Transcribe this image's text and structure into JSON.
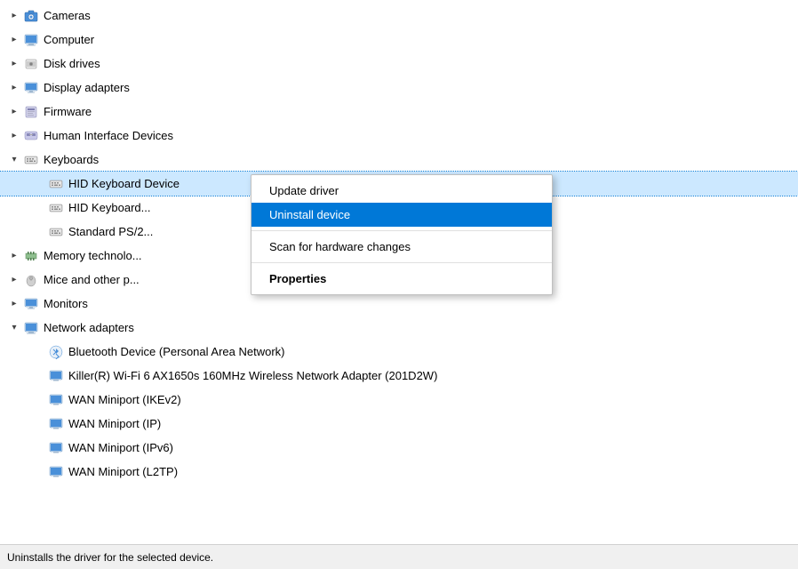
{
  "statusBar": {
    "text": "Uninstalls the driver for the selected device."
  },
  "contextMenu": {
    "items": [
      {
        "id": "update-driver",
        "label": "Update driver",
        "bold": false,
        "active": false
      },
      {
        "id": "uninstall-device",
        "label": "Uninstall device",
        "bold": false,
        "active": true
      },
      {
        "divider": true
      },
      {
        "id": "scan-changes",
        "label": "Scan for hardware changes",
        "bold": false,
        "active": false
      },
      {
        "divider": true
      },
      {
        "id": "properties",
        "label": "Properties",
        "bold": true,
        "active": false
      }
    ]
  },
  "tree": {
    "items": [
      {
        "id": "cameras",
        "label": "Cameras",
        "level": 0,
        "arrow": "collapsed",
        "icon": "camera"
      },
      {
        "id": "computer",
        "label": "Computer",
        "level": 0,
        "arrow": "collapsed",
        "icon": "computer"
      },
      {
        "id": "disk-drives",
        "label": "Disk drives",
        "level": 0,
        "arrow": "collapsed",
        "icon": "disk"
      },
      {
        "id": "display-adapters",
        "label": "Display adapters",
        "level": 0,
        "arrow": "collapsed",
        "icon": "display"
      },
      {
        "id": "firmware",
        "label": "Firmware",
        "level": 0,
        "arrow": "collapsed",
        "icon": "firmware"
      },
      {
        "id": "human-interface",
        "label": "Human Interface Devices",
        "level": 0,
        "arrow": "collapsed",
        "icon": "hid"
      },
      {
        "id": "keyboards",
        "label": "Keyboards",
        "level": 0,
        "arrow": "expanded",
        "icon": "keyboard"
      },
      {
        "id": "hid-keyboard-1",
        "label": "HID Keyboard Device",
        "level": 1,
        "arrow": "empty",
        "icon": "keyboard-small",
        "selected": true
      },
      {
        "id": "hid-keyboard-2",
        "label": "HID Keyboard...",
        "level": 1,
        "arrow": "empty",
        "icon": "keyboard-small"
      },
      {
        "id": "standard-ps2",
        "label": "Standard PS/2...",
        "level": 1,
        "arrow": "empty",
        "icon": "keyboard-small"
      },
      {
        "id": "memory-tech",
        "label": "Memory technolo...",
        "level": 0,
        "arrow": "collapsed",
        "icon": "memory"
      },
      {
        "id": "mice",
        "label": "Mice and other p...",
        "level": 0,
        "arrow": "collapsed",
        "icon": "mouse"
      },
      {
        "id": "monitors",
        "label": "Monitors",
        "level": 0,
        "arrow": "collapsed",
        "icon": "monitor"
      },
      {
        "id": "network-adapters",
        "label": "Network adapters",
        "level": 0,
        "arrow": "expanded",
        "icon": "network"
      },
      {
        "id": "bluetooth",
        "label": "Bluetooth Device (Personal Area Network)",
        "level": 1,
        "arrow": "empty",
        "icon": "bluetooth"
      },
      {
        "id": "killer-wifi",
        "label": "Killer(R) Wi-Fi 6 AX1650s 160MHz Wireless Network Adapter (201D2W)",
        "level": 1,
        "arrow": "empty",
        "icon": "network-adapter"
      },
      {
        "id": "wan-ikev2",
        "label": "WAN Miniport (IKEv2)",
        "level": 1,
        "arrow": "empty",
        "icon": "network-adapter"
      },
      {
        "id": "wan-ip",
        "label": "WAN Miniport (IP)",
        "level": 1,
        "arrow": "empty",
        "icon": "network-adapter"
      },
      {
        "id": "wan-ipv6",
        "label": "WAN Miniport (IPv6)",
        "level": 1,
        "arrow": "empty",
        "icon": "network-adapter"
      },
      {
        "id": "wan-l2tp",
        "label": "WAN Miniport (L2TP)",
        "level": 1,
        "arrow": "empty",
        "icon": "network-adapter"
      }
    ]
  }
}
